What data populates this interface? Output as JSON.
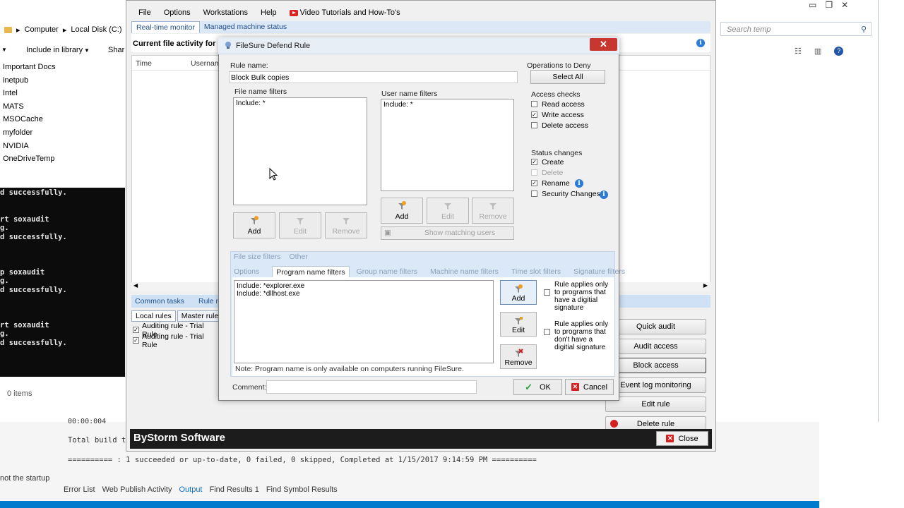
{
  "explorer": {
    "address": [
      "Computer",
      "Local Disk (C:)"
    ],
    "toolbar": {
      "include": "Include in library",
      "share": "Shar"
    },
    "nav_items": [
      "Important Docs",
      "inetpub",
      "Intel",
      "MATS",
      "MSOCache",
      "myfolder",
      "NVIDIA",
      "OneDriveTemp"
    ],
    "console_lines": [
      "d successfully.",
      "",
      "",
      "rt soxaudit",
      "g.",
      "d successfully.",
      "",
      "",
      "",
      "p soxaudit",
      "g.",
      "d successfully.",
      "",
      "",
      "",
      "rt soxaudit",
      "g.",
      "d successfully."
    ],
    "items_count": "0 items",
    "search_placeholder": "Search temp"
  },
  "vs": {
    "line1": "00:00:004",
    "line2": "Total build t",
    "line3": "========== : 1 succeeded or up-to-date, 0 failed, 0 skipped, Completed at 1/15/2017 9:14:59 PM ==========",
    "side_text": "not the startup",
    "tabs": [
      "Error List",
      "Web Publish Activity",
      "Output",
      "Find Results 1",
      "Find Symbol Results"
    ],
    "active_tab": "Output"
  },
  "filesure": {
    "menu": [
      "File",
      "Options",
      "Workstations",
      "Help"
    ],
    "video_link": "Video Tutorials and How-To's",
    "tabs": [
      "Real-time monitor",
      "Managed machine status"
    ],
    "activity_label": "Current file activity for :",
    "grid_cols": [
      "Time",
      "Usernam"
    ],
    "bottom_tabs": [
      "Common tasks",
      "Rule ma"
    ],
    "rules_tabs": [
      "Local rules",
      "Master rules"
    ],
    "rules": [
      "Auditing rule - Trial Rule",
      "Auditing rule - Trial Rule"
    ],
    "right_buttons": [
      "Quick audit",
      "Audit access",
      "Block access",
      "Event log monitoring",
      "Edit rule",
      "Delete rule"
    ],
    "brand": "ByStorm Software",
    "close_label": "Close"
  },
  "dialog": {
    "title": "FileSure Defend Rule",
    "rule_name_label": "Rule name:",
    "rule_name_value": "Block Bulk copies",
    "file_filters_label": "File name filters",
    "file_filters": [
      "Include: *"
    ],
    "user_filters_label": "User name filters",
    "user_filters": [
      "Include: *"
    ],
    "btn_add": "Add",
    "btn_edit": "Edit",
    "btn_remove": "Remove",
    "show_matching": "Show matching users",
    "ops_label": "Operations to Deny",
    "select_all": "Select All",
    "access_label": "Access checks",
    "access": [
      {
        "label": "Read access",
        "checked": false
      },
      {
        "label": "Write access",
        "checked": true
      },
      {
        "label": "Delete access",
        "checked": false
      }
    ],
    "status_label": "Status changes",
    "status": [
      {
        "label": "Create",
        "checked": true,
        "disabled": false
      },
      {
        "label": "Delete",
        "checked": false,
        "disabled": true
      },
      {
        "label": "Rename",
        "checked": true,
        "disabled": false
      },
      {
        "label": "Security Changes",
        "checked": false,
        "disabled": false
      }
    ],
    "filter_tabs_row1": [
      "File size filters",
      "Other"
    ],
    "filter_tabs_row2": [
      "Options",
      "Program name filters",
      "Group name filters",
      "Machine name filters",
      "Time slot filters",
      "Signature filters"
    ],
    "active_filter_tab": "Program name filters",
    "program_filters": [
      "Include: *explorer.exe",
      "Include: *dllhost.exe"
    ],
    "sig_opt1": "Rule applies only to programs that have a digitial signature",
    "sig_opt2": "Rule applies only to programs that don't have a digitial signature",
    "note": "Note: Program name is only available on computers running FileSure.",
    "comment_label": "Comment:",
    "comment_value": "",
    "ok": "OK",
    "cancel": "Cancel"
  },
  "colors": {
    "accent": "#2c7bd6",
    "danger": "#d42020",
    "ok_green": "#24a33a"
  }
}
